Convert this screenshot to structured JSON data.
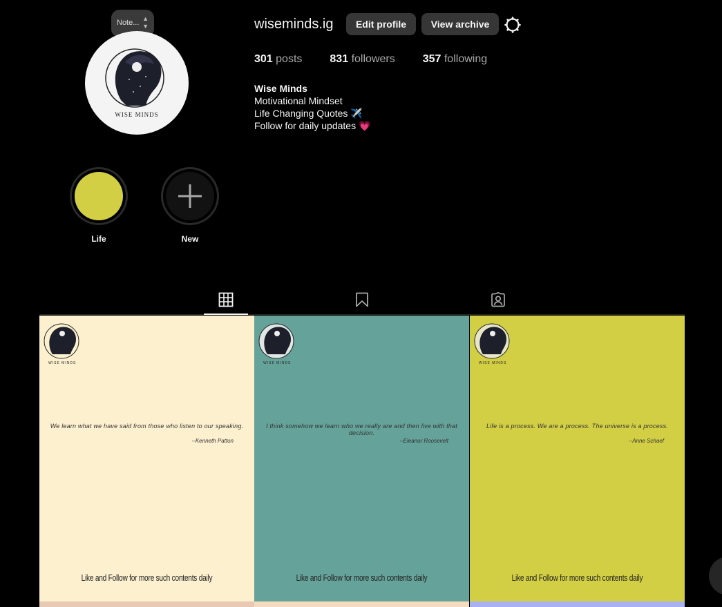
{
  "profile": {
    "username": "wiseminds.ig",
    "edit_label": "Edit profile",
    "archive_label": "View archive",
    "note_text": "Note...",
    "avatar_brand": "WISE MINDS",
    "stats": {
      "posts_count": "301",
      "posts_label": "posts",
      "followers_count": "831",
      "followers_label": "followers",
      "following_count": "357",
      "following_label": "following"
    },
    "bio": {
      "name": "Wise Minds",
      "line1": "Motivational Mindset",
      "line2": "Life Changing Quotes ✈️",
      "line3": "Follow for daily updates 💗"
    }
  },
  "highlights": [
    {
      "label": "Life",
      "color": "#d2cf45"
    },
    {
      "label": "New",
      "icon": "plus-icon"
    }
  ],
  "tabs": [
    {
      "name": "posts",
      "icon": "grid-icon",
      "active": true
    },
    {
      "name": "saved",
      "icon": "bookmark-icon",
      "active": false
    },
    {
      "name": "tagged",
      "icon": "tagged-user-icon",
      "active": false
    }
  ],
  "posts": [
    {
      "bg": "#fdf0cf",
      "brand": "WISE MINDS",
      "quote": "We learn what we have said from those who listen to our speaking.",
      "author": "--Kenneth Patton",
      "cta": "Like and Follow for more such contents daily"
    },
    {
      "bg": "#65a299",
      "brand": "WISE MINDS",
      "quote": "I think somehow we learn who we really are and then live with that decision.",
      "author": "--Eleanor Roosevelt",
      "cta": "Like and Follow for more such contents daily"
    },
    {
      "bg": "#d2cf45",
      "brand": "WISE MINDS",
      "quote": "Life is a process. We are a process. The universe is a process.",
      "author": "--Anne Schaef",
      "cta": "Like and Follow for more such contents daily"
    }
  ],
  "next_row_colors": [
    "#e8c9b4",
    "#f3dcbc",
    "#aab1f2"
  ]
}
